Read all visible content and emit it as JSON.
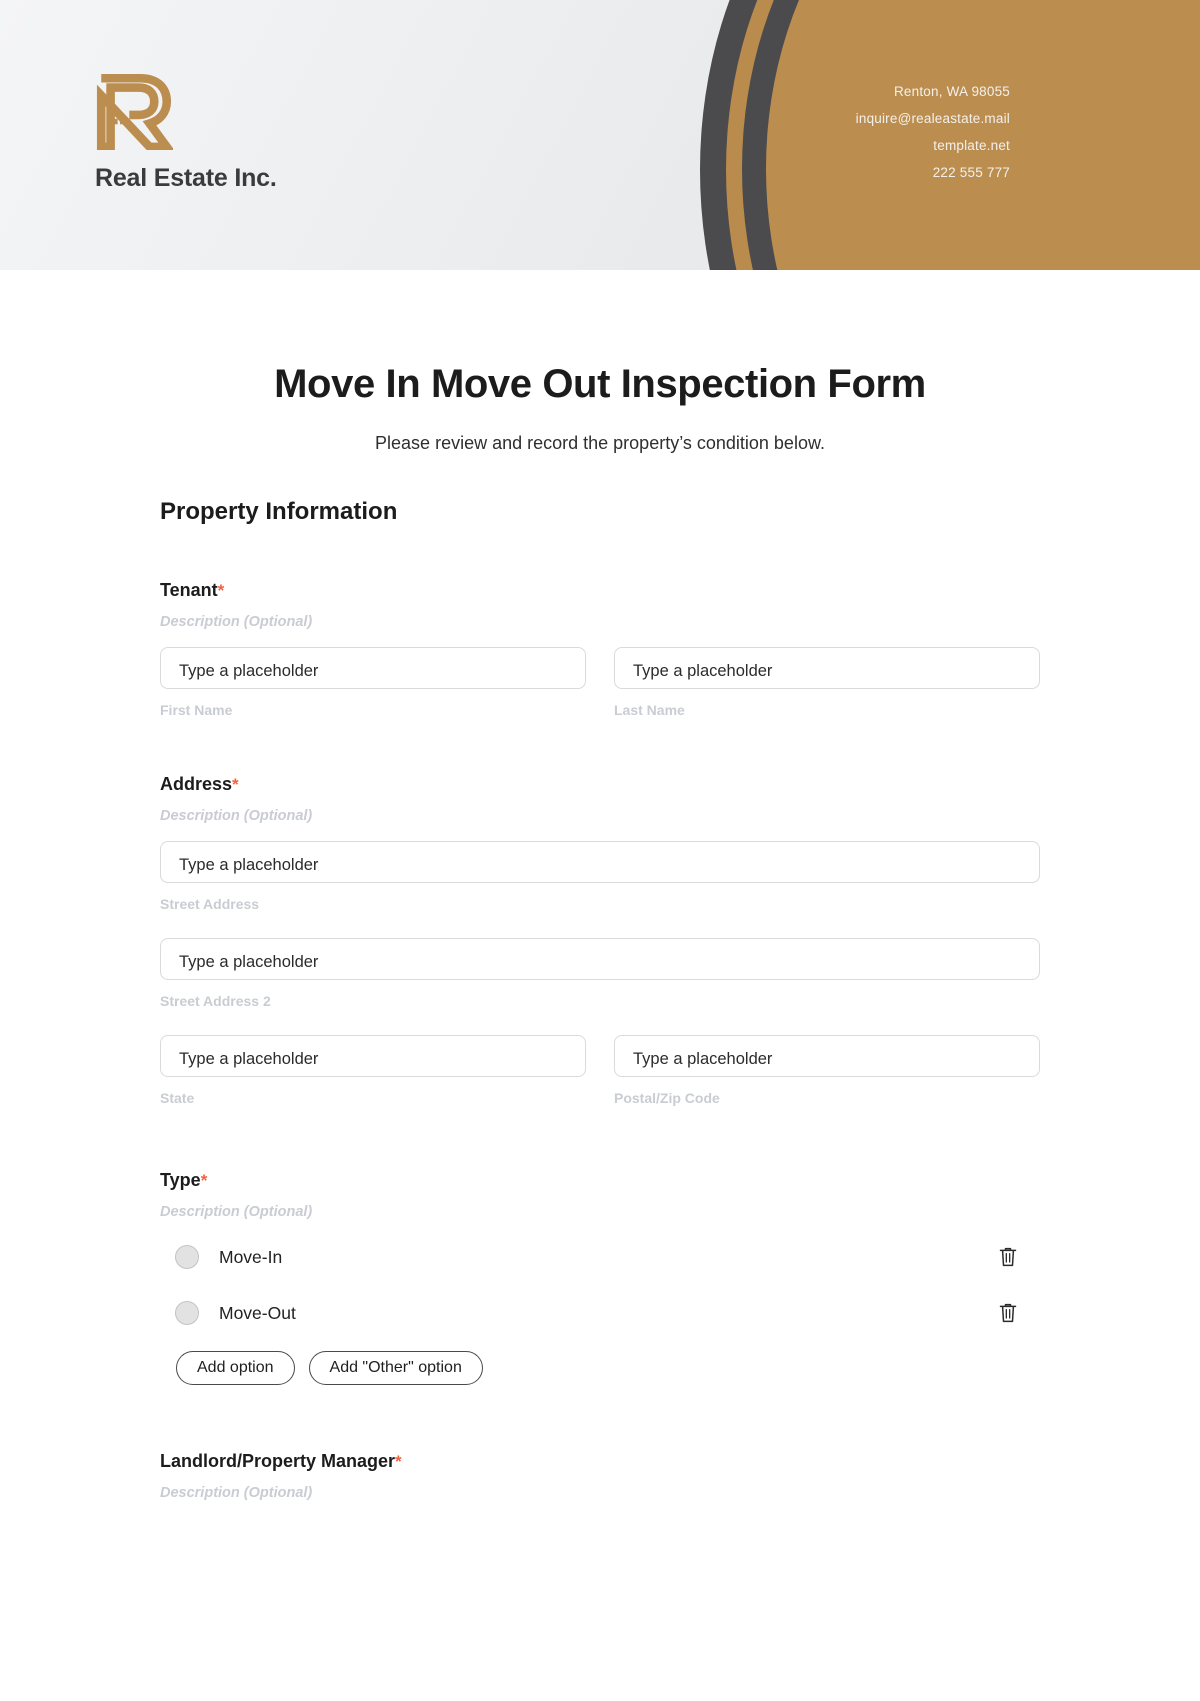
{
  "header": {
    "logo": {
      "mark_icon": "stylized-r-house-logo",
      "brand_name": "Real Estate Inc."
    },
    "brand_color": "#bb8e4f",
    "dark_color": "#4b4b4e",
    "contact": [
      "Renton, WA 98055",
      "inquire@realeastate.mail",
      "template.net",
      "222 555 777"
    ]
  },
  "form": {
    "title": "Move In Move Out Inspection Form",
    "subtitle": "Please review and record the property’s condition below.",
    "section_heading": "Property Information",
    "required_marker": "*",
    "description_placeholder": "Description (Optional)",
    "input_placeholder": "Type a placeholder",
    "required_color": "#f4603e",
    "fields": [
      {
        "label": "Tenant",
        "required": true,
        "description": "Description (Optional)",
        "rows": [
          {
            "columns": [
              {
                "value": "Type a placeholder",
                "sub_label": "First Name"
              },
              {
                "value": "Type a placeholder",
                "sub_label": "Last Name"
              }
            ]
          }
        ]
      },
      {
        "label": "Address",
        "required": true,
        "description": "Description (Optional)",
        "rows": [
          {
            "columns": [
              {
                "value": "Type a placeholder",
                "sub_label": "Street Address"
              }
            ]
          },
          {
            "columns": [
              {
                "value": "Type a placeholder",
                "sub_label": "Street Address 2"
              }
            ]
          },
          {
            "columns": [
              {
                "value": "Type a placeholder",
                "sub_label": "State"
              },
              {
                "value": "Type a placeholder",
                "sub_label": "Postal/Zip Code"
              }
            ]
          }
        ]
      },
      {
        "label": "Type",
        "required": true,
        "description": "Description (Optional)",
        "options": [
          {
            "label": "Move-In",
            "selected": false,
            "delete_icon": "trash-icon"
          },
          {
            "label": "Move-Out",
            "selected": false,
            "delete_icon": "trash-icon"
          }
        ],
        "buttons": [
          {
            "label": "Add option"
          },
          {
            "label": "Add \"Other\" option"
          }
        ]
      },
      {
        "label": "Landlord/Property Manager",
        "required": true,
        "description": "Description (Optional)"
      }
    ]
  }
}
